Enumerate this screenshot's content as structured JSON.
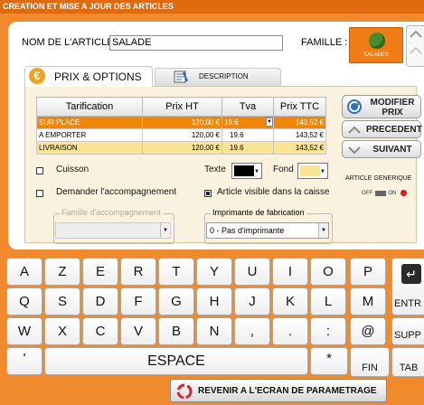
{
  "window": {
    "title": "CREATION ET MISE A JOUR DES ARTICLES"
  },
  "article": {
    "name_label": "NOM DE L'ARTICLE :",
    "name_value": "SALADE"
  },
  "family": {
    "label": "FAMILLE :",
    "tile_label": "SALADES"
  },
  "tabs": [
    {
      "label": "PRIX & OPTIONS",
      "icon": "euro-icon"
    },
    {
      "label": "DESCRIPTION",
      "icon": "description-icon"
    }
  ],
  "pricing": {
    "headers": [
      "Tarification",
      "Prix HT",
      "Tva",
      "Prix TTC"
    ],
    "rows": [
      [
        "SUR PLACE",
        "120,00 €",
        "19.6",
        "143,52 €"
      ],
      [
        "A EMPORTER",
        "120,00 €",
        "19.6",
        "143,52 €"
      ],
      [
        "LIVRAISON",
        "120,00 €",
        "19.6",
        "143,52 €"
      ]
    ]
  },
  "side_buttons": {
    "modify_line1": "MODIFIER",
    "modify_line2": "PRIX",
    "previous": "PRECEDENT",
    "next": "SUIVANT"
  },
  "options": {
    "cuisson": "Cuisson",
    "accompagnement": "Demander l'accompagnement",
    "texte_label": "Texte",
    "fond_label": "Fond",
    "visible": "Article visible dans la caisse",
    "generic_label": "ARTICLE GENERIQUE",
    "toggle_off": "OFF",
    "toggle_on": "ON",
    "famille_accomp_legend": "Famille d'accompagnement",
    "imprimante_legend": "Imprimante de fabrication",
    "imprimante_value": "0 - Pas d'imprimante"
  },
  "colors": {
    "accent": "#f08a2c",
    "row_selected": "#f0860c",
    "row_alt": "#fbe494",
    "texte_color": "#000000",
    "fond_color": "#fbe494"
  },
  "keyboard": {
    "row1": [
      "A",
      "Z",
      "E",
      "R",
      "T",
      "Y",
      "U",
      "I",
      "O",
      "P"
    ],
    "row2": [
      "Q",
      "S",
      "D",
      "F",
      "G",
      "H",
      "J",
      "K",
      "L",
      "M"
    ],
    "row3": [
      "W",
      "X",
      "C",
      "V",
      "B",
      "N",
      ",",
      ".",
      ":",
      "@"
    ],
    "row4_left": "'",
    "space": "ESPACE",
    "star": "*",
    "fin": "FIN",
    "enter": "ENTR",
    "supp": "SUPP",
    "tab": "TAB"
  },
  "back_button": {
    "label": "REVENIR A L'ECRAN DE PARAMETRAGE"
  }
}
